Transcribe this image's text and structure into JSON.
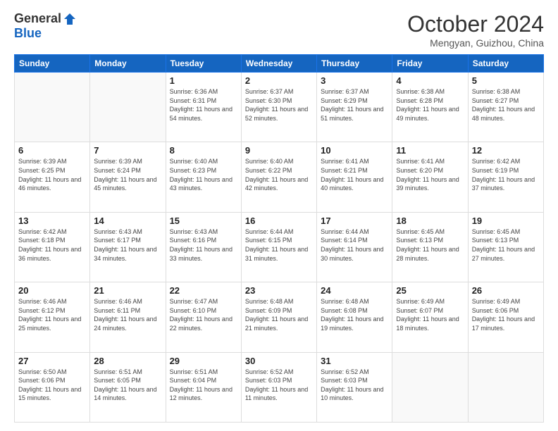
{
  "header": {
    "logo_general": "General",
    "logo_blue": "Blue",
    "month_title": "October 2024",
    "location": "Mengyan, Guizhou, China"
  },
  "days_of_week": [
    "Sunday",
    "Monday",
    "Tuesday",
    "Wednesday",
    "Thursday",
    "Friday",
    "Saturday"
  ],
  "weeks": [
    [
      {
        "day": "",
        "info": ""
      },
      {
        "day": "",
        "info": ""
      },
      {
        "day": "1",
        "info": "Sunrise: 6:36 AM\nSunset: 6:31 PM\nDaylight: 11 hours and 54 minutes."
      },
      {
        "day": "2",
        "info": "Sunrise: 6:37 AM\nSunset: 6:30 PM\nDaylight: 11 hours and 52 minutes."
      },
      {
        "day": "3",
        "info": "Sunrise: 6:37 AM\nSunset: 6:29 PM\nDaylight: 11 hours and 51 minutes."
      },
      {
        "day": "4",
        "info": "Sunrise: 6:38 AM\nSunset: 6:28 PM\nDaylight: 11 hours and 49 minutes."
      },
      {
        "day": "5",
        "info": "Sunrise: 6:38 AM\nSunset: 6:27 PM\nDaylight: 11 hours and 48 minutes."
      }
    ],
    [
      {
        "day": "6",
        "info": "Sunrise: 6:39 AM\nSunset: 6:25 PM\nDaylight: 11 hours and 46 minutes."
      },
      {
        "day": "7",
        "info": "Sunrise: 6:39 AM\nSunset: 6:24 PM\nDaylight: 11 hours and 45 minutes."
      },
      {
        "day": "8",
        "info": "Sunrise: 6:40 AM\nSunset: 6:23 PM\nDaylight: 11 hours and 43 minutes."
      },
      {
        "day": "9",
        "info": "Sunrise: 6:40 AM\nSunset: 6:22 PM\nDaylight: 11 hours and 42 minutes."
      },
      {
        "day": "10",
        "info": "Sunrise: 6:41 AM\nSunset: 6:21 PM\nDaylight: 11 hours and 40 minutes."
      },
      {
        "day": "11",
        "info": "Sunrise: 6:41 AM\nSunset: 6:20 PM\nDaylight: 11 hours and 39 minutes."
      },
      {
        "day": "12",
        "info": "Sunrise: 6:42 AM\nSunset: 6:19 PM\nDaylight: 11 hours and 37 minutes."
      }
    ],
    [
      {
        "day": "13",
        "info": "Sunrise: 6:42 AM\nSunset: 6:18 PM\nDaylight: 11 hours and 36 minutes."
      },
      {
        "day": "14",
        "info": "Sunrise: 6:43 AM\nSunset: 6:17 PM\nDaylight: 11 hours and 34 minutes."
      },
      {
        "day": "15",
        "info": "Sunrise: 6:43 AM\nSunset: 6:16 PM\nDaylight: 11 hours and 33 minutes."
      },
      {
        "day": "16",
        "info": "Sunrise: 6:44 AM\nSunset: 6:15 PM\nDaylight: 11 hours and 31 minutes."
      },
      {
        "day": "17",
        "info": "Sunrise: 6:44 AM\nSunset: 6:14 PM\nDaylight: 11 hours and 30 minutes."
      },
      {
        "day": "18",
        "info": "Sunrise: 6:45 AM\nSunset: 6:13 PM\nDaylight: 11 hours and 28 minutes."
      },
      {
        "day": "19",
        "info": "Sunrise: 6:45 AM\nSunset: 6:13 PM\nDaylight: 11 hours and 27 minutes."
      }
    ],
    [
      {
        "day": "20",
        "info": "Sunrise: 6:46 AM\nSunset: 6:12 PM\nDaylight: 11 hours and 25 minutes."
      },
      {
        "day": "21",
        "info": "Sunrise: 6:46 AM\nSunset: 6:11 PM\nDaylight: 11 hours and 24 minutes."
      },
      {
        "day": "22",
        "info": "Sunrise: 6:47 AM\nSunset: 6:10 PM\nDaylight: 11 hours and 22 minutes."
      },
      {
        "day": "23",
        "info": "Sunrise: 6:48 AM\nSunset: 6:09 PM\nDaylight: 11 hours and 21 minutes."
      },
      {
        "day": "24",
        "info": "Sunrise: 6:48 AM\nSunset: 6:08 PM\nDaylight: 11 hours and 19 minutes."
      },
      {
        "day": "25",
        "info": "Sunrise: 6:49 AM\nSunset: 6:07 PM\nDaylight: 11 hours and 18 minutes."
      },
      {
        "day": "26",
        "info": "Sunrise: 6:49 AM\nSunset: 6:06 PM\nDaylight: 11 hours and 17 minutes."
      }
    ],
    [
      {
        "day": "27",
        "info": "Sunrise: 6:50 AM\nSunset: 6:06 PM\nDaylight: 11 hours and 15 minutes."
      },
      {
        "day": "28",
        "info": "Sunrise: 6:51 AM\nSunset: 6:05 PM\nDaylight: 11 hours and 14 minutes."
      },
      {
        "day": "29",
        "info": "Sunrise: 6:51 AM\nSunset: 6:04 PM\nDaylight: 11 hours and 12 minutes."
      },
      {
        "day": "30",
        "info": "Sunrise: 6:52 AM\nSunset: 6:03 PM\nDaylight: 11 hours and 11 minutes."
      },
      {
        "day": "31",
        "info": "Sunrise: 6:52 AM\nSunset: 6:03 PM\nDaylight: 11 hours and 10 minutes."
      },
      {
        "day": "",
        "info": ""
      },
      {
        "day": "",
        "info": ""
      }
    ]
  ]
}
